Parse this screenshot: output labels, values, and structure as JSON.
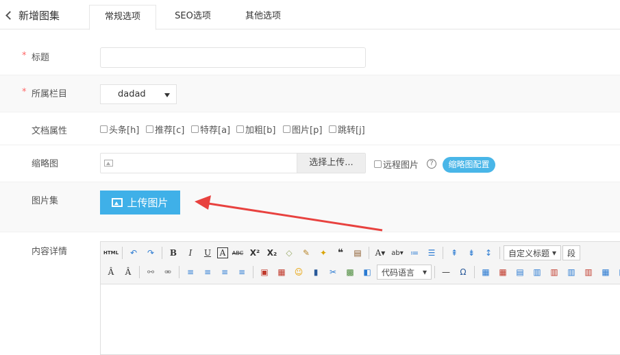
{
  "header": {
    "back_label": "新增图集",
    "tabs": [
      "常规选项",
      "SEO选项",
      "其他选项"
    ],
    "active_tab": 0
  },
  "form": {
    "required_mark": "*",
    "title": {
      "label": "标题",
      "value": ""
    },
    "column": {
      "label": "所属栏目",
      "selected": "dadad"
    },
    "attributes": {
      "label": "文档属性",
      "options": [
        "头条[h]",
        "推荐[c]",
        "特荐[a]",
        "加粗[b]",
        "图片[p]",
        "跳转[j]"
      ]
    },
    "thumbnail": {
      "label": "缩略图",
      "select_button": "选择上传...",
      "remote_label": "远程图片",
      "help": "?",
      "config_button": "缩略图配置"
    },
    "gallery": {
      "label": "图片集",
      "upload_button": "上传图片"
    },
    "content": {
      "label": "内容详情"
    }
  },
  "editor": {
    "heading_select": "自定义标题",
    "paragraph_select": "段",
    "code_select": "代码语言"
  },
  "colors": {
    "accent": "#3fb0e8",
    "arrow": "#e8423f",
    "required": "#ff6666"
  }
}
